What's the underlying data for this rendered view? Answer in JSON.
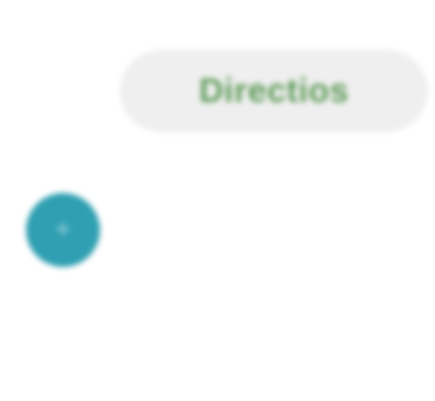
{
  "directions": {
    "label": "Directios"
  },
  "fab": {
    "icon": "plus-icon",
    "glyph": "+"
  }
}
